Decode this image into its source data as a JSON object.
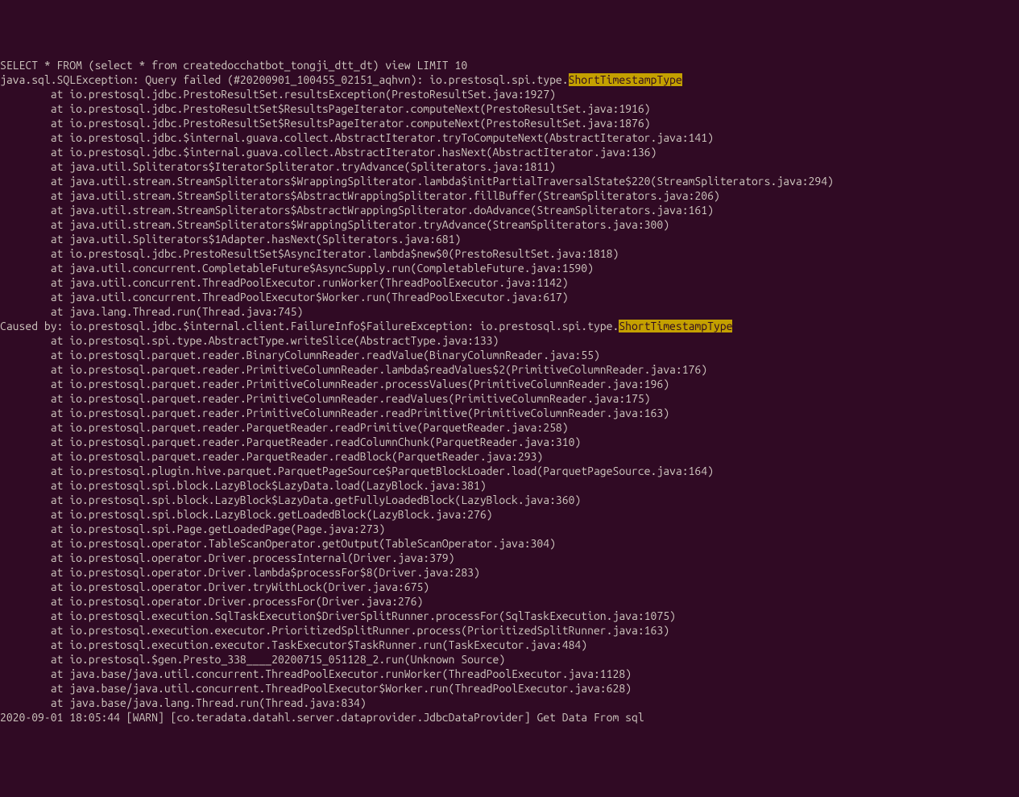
{
  "stacktrace": {
    "line0": "SELECT * FROM (select * from createdocchatbot_tongji_dtt_dt) view LIMIT 10",
    "line1_a": "java.sql.SQLException: Query failed (#20200901_100455_02151_aqhvn): io.prestosql.spi.type.",
    "line1_highlight": "ShortTimestampType",
    "trace1": [
      "        at io.prestosql.jdbc.PrestoResultSet.resultsException(PrestoResultSet.java:1927)",
      "        at io.prestosql.jdbc.PrestoResultSet$ResultsPageIterator.computeNext(PrestoResultSet.java:1916)",
      "        at io.prestosql.jdbc.PrestoResultSet$ResultsPageIterator.computeNext(PrestoResultSet.java:1876)",
      "        at io.prestosql.jdbc.$internal.guava.collect.AbstractIterator.tryToComputeNext(AbstractIterator.java:141)",
      "        at io.prestosql.jdbc.$internal.guava.collect.AbstractIterator.hasNext(AbstractIterator.java:136)",
      "        at java.util.Spliterators$IteratorSpliterator.tryAdvance(Spliterators.java:1811)",
      "        at java.util.stream.StreamSpliterators$WrappingSpliterator.lambda$initPartialTraversalState$220(StreamSpliterators.java:294)",
      "        at java.util.stream.StreamSpliterators$AbstractWrappingSpliterator.fillBuffer(StreamSpliterators.java:206)",
      "        at java.util.stream.StreamSpliterators$AbstractWrappingSpliterator.doAdvance(StreamSpliterators.java:161)",
      "        at java.util.stream.StreamSpliterators$WrappingSpliterator.tryAdvance(StreamSpliterators.java:300)",
      "        at java.util.Spliterators$1Adapter.hasNext(Spliterators.java:681)",
      "        at io.prestosql.jdbc.PrestoResultSet$AsyncIterator.lambda$new$0(PrestoResultSet.java:1818)",
      "        at java.util.concurrent.CompletableFuture$AsyncSupply.run(CompletableFuture.java:1590)",
      "        at java.util.concurrent.ThreadPoolExecutor.runWorker(ThreadPoolExecutor.java:1142)",
      "        at java.util.concurrent.ThreadPoolExecutor$Worker.run(ThreadPoolExecutor.java:617)",
      "        at java.lang.Thread.run(Thread.java:745)"
    ],
    "causedby_a": "Caused by: io.prestosql.jdbc.$internal.client.FailureInfo$FailureException: io.prestosql.spi.type.",
    "causedby_highlight": "ShortTimestampType",
    "trace2": [
      "        at io.prestosql.spi.type.AbstractType.writeSlice(AbstractType.java:133)",
      "        at io.prestosql.parquet.reader.BinaryColumnReader.readValue(BinaryColumnReader.java:55)",
      "        at io.prestosql.parquet.reader.PrimitiveColumnReader.lambda$readValues$2(PrimitiveColumnReader.java:176)",
      "        at io.prestosql.parquet.reader.PrimitiveColumnReader.processValues(PrimitiveColumnReader.java:196)",
      "        at io.prestosql.parquet.reader.PrimitiveColumnReader.readValues(PrimitiveColumnReader.java:175)",
      "        at io.prestosql.parquet.reader.PrimitiveColumnReader.readPrimitive(PrimitiveColumnReader.java:163)",
      "        at io.prestosql.parquet.reader.ParquetReader.readPrimitive(ParquetReader.java:258)",
      "        at io.prestosql.parquet.reader.ParquetReader.readColumnChunk(ParquetReader.java:310)",
      "        at io.prestosql.parquet.reader.ParquetReader.readBlock(ParquetReader.java:293)",
      "        at io.prestosql.plugin.hive.parquet.ParquetPageSource$ParquetBlockLoader.load(ParquetPageSource.java:164)",
      "        at io.prestosql.spi.block.LazyBlock$LazyData.load(LazyBlock.java:381)",
      "        at io.prestosql.spi.block.LazyBlock$LazyData.getFullyLoadedBlock(LazyBlock.java:360)",
      "        at io.prestosql.spi.block.LazyBlock.getLoadedBlock(LazyBlock.java:276)",
      "        at io.prestosql.spi.Page.getLoadedPage(Page.java:273)",
      "        at io.prestosql.operator.TableScanOperator.getOutput(TableScanOperator.java:304)",
      "        at io.prestosql.operator.Driver.processInternal(Driver.java:379)",
      "        at io.prestosql.operator.Driver.lambda$processFor$8(Driver.java:283)",
      "        at io.prestosql.operator.Driver.tryWithLock(Driver.java:675)",
      "        at io.prestosql.operator.Driver.processFor(Driver.java:276)",
      "        at io.prestosql.execution.SqlTaskExecution$DriverSplitRunner.processFor(SqlTaskExecution.java:1075)",
      "        at io.prestosql.execution.executor.PrioritizedSplitRunner.process(PrioritizedSplitRunner.java:163)",
      "        at io.prestosql.execution.executor.TaskExecutor$TaskRunner.run(TaskExecutor.java:484)",
      "        at io.prestosql.$gen.Presto_338____20200715_051128_2.run(Unknown Source)",
      "        at java.base/java.util.concurrent.ThreadPoolExecutor.runWorker(ThreadPoolExecutor.java:1128)",
      "        at java.base/java.util.concurrent.ThreadPoolExecutor$Worker.run(ThreadPoolExecutor.java:628)",
      "        at java.base/java.lang.Thread.run(Thread.java:834)"
    ],
    "lastline": "2020-09-01 18:05:44 [WARN] [co.teradata.datahl.server.dataprovider.JdbcDataProvider] Get Data From sql"
  }
}
